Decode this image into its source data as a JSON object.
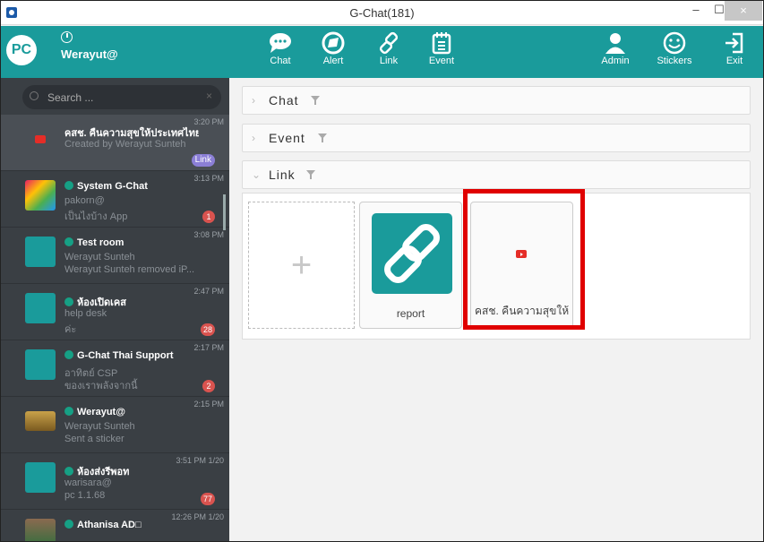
{
  "window": {
    "title": "G-Chat(181)",
    "min": "–",
    "max": "☐",
    "close": "×"
  },
  "header": {
    "logo": "PC",
    "username": "Werayut@"
  },
  "toolbar": {
    "chat": "Chat",
    "alert": "Alert",
    "link": "Link",
    "event": "Event",
    "admin": "Admin",
    "stickers": "Stickers",
    "exit": "Exit"
  },
  "search": {
    "placeholder": "Search ...",
    "clear": "×"
  },
  "conversations": [
    {
      "name": "คสช. คืนความสุขให้ประเทศไทย",
      "line2": "Created by Werayut Sunteh",
      "line3": "",
      "time": "3:20 PM",
      "badge": "Link"
    },
    {
      "name": "System G-Chat",
      "line2": "pakorn@",
      "line3": "เป็นไงบ้าง App",
      "time": "3:13 PM",
      "badge": "1"
    },
    {
      "name": "Test room",
      "line2": "Werayut Sunteh",
      "line3": "Werayut Sunteh removed iP...",
      "time": "3:08 PM",
      "badge": ""
    },
    {
      "name": "ห้องเปิดเคส",
      "line2": "help desk",
      "line3": "ค่ะ",
      "time": "2:47 PM",
      "badge": "28"
    },
    {
      "name": "G-Chat Thai Support",
      "line2": "อาทิตย์ CSP",
      "line3": "ของเราพลังจากนี้",
      "time": "2:17 PM",
      "badge": "2"
    },
    {
      "name": "Werayut@",
      "line2": "Werayut Sunteh",
      "line3": "Sent a sticker",
      "time": "2:15 PM",
      "badge": ""
    },
    {
      "name": "ห้องส่งรีพอท",
      "line2": "warisara@",
      "line3": "pc 1.1.68",
      "time": "3:51 PM 1/20",
      "badge": "77"
    },
    {
      "name": "Athanisa AD□",
      "line2": "",
      "line3": "",
      "time": "12:26 PM 1/20",
      "badge": ""
    }
  ],
  "sections": {
    "chat": "Chat",
    "event": "Event",
    "link": "Link"
  },
  "links": {
    "add": "+",
    "card1": "report",
    "card2": "คสช. คืนความสุขให้..."
  },
  "colors": {
    "accent": "#1a9b9b",
    "sidebar": "#3a3f44",
    "badge": "#d9534f",
    "highlight": "#e00000"
  }
}
